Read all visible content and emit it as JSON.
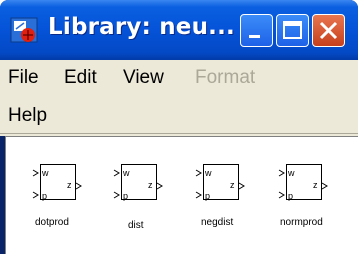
{
  "window": {
    "title": "Library: neu..."
  },
  "menu": {
    "file": "File",
    "edit": "Edit",
    "view": "View",
    "format": "Format",
    "help": "Help"
  },
  "blocks": [
    {
      "name": "dotprod",
      "in1": "w",
      "in2": "p",
      "out": "z"
    },
    {
      "name": "dist",
      "in1": "w",
      "in2": "p",
      "out": "z"
    },
    {
      "name": "negdist",
      "in1": "w",
      "in2": "p",
      "out": "z"
    },
    {
      "name": "normprod",
      "in1": "w",
      "in2": "p",
      "out": "z"
    }
  ],
  "colors": {
    "titlebar": "#0553d8",
    "menu_bg": "#ece9d8",
    "close": "#c7401d",
    "disabled": "#aca899"
  }
}
